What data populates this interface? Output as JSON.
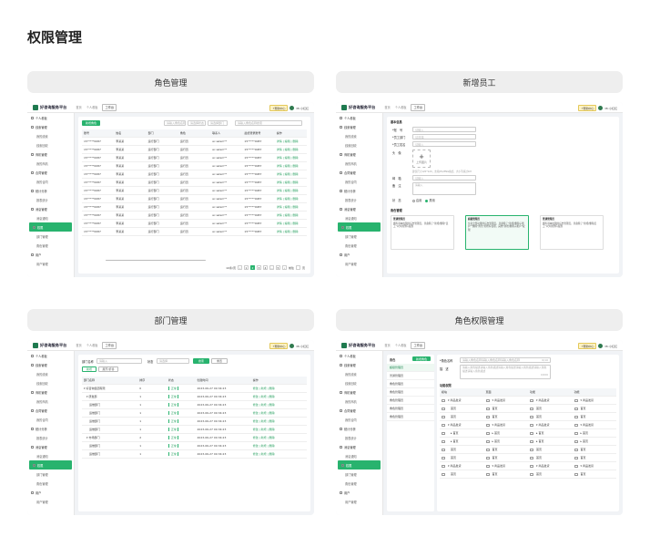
{
  "page_title": "权限管理",
  "panels": {
    "role": {
      "label": "角色管理"
    },
    "new_employee": {
      "label": "新增员工"
    },
    "dept": {
      "label": "部门管理"
    },
    "role_perm": {
      "label": "角色权限管理"
    }
  },
  "app": {
    "brand": "好咨询服务平台",
    "nav": [
      "首页",
      "个人看板",
      "工作台"
    ],
    "help": "⚡帮助中心",
    "user": "Mr.小红红"
  },
  "sidebar": [
    {
      "label": "个人看板",
      "sub": false
    },
    {
      "label": "线索管理",
      "sub": false
    },
    {
      "label": "我的线索",
      "sub": true
    },
    {
      "label": "线索回收",
      "sub": true
    },
    {
      "label": "商机管理",
      "sub": false
    },
    {
      "label": "我的商机",
      "sub": true
    },
    {
      "label": "合同管理",
      "sub": false
    },
    {
      "label": "我的合同",
      "sub": true
    },
    {
      "label": "统计分析",
      "sub": false
    },
    {
      "label": "报表统计",
      "sub": true
    },
    {
      "label": "消息管理",
      "sub": false
    },
    {
      "label": "消息通知",
      "sub": true
    },
    {
      "label": "权限",
      "sub": false,
      "active": true
    },
    {
      "label": "部门管理",
      "sub": true
    },
    {
      "label": "角色管理",
      "sub": true
    },
    {
      "label": "用户",
      "sub": false
    },
    {
      "label": "用户管理",
      "sub": true
    }
  ],
  "role_mgmt": {
    "add_button": "新增角色",
    "filters": [
      "请输入角色名称",
      "请选择状态",
      "请选择部门"
    ],
    "search_placeholder": "请输入角色名称搜索",
    "columns": [
      "账号",
      "姓名",
      "部门",
      "角色",
      "联系人",
      "最终登录账号",
      "操作"
    ],
    "rows": [
      [
        "15*****0087",
        "李某某",
        "运行部门",
        "运行员",
        "ac.wksm**",
        "15*****0087",
        "详情 | 编辑 | 删除"
      ],
      [
        "15*****0087",
        "李某某",
        "运行部门",
        "运行员",
        "ac.wksm**",
        "15*****0087",
        "详情 | 编辑 | 删除"
      ],
      [
        "15*****0087",
        "李某某",
        "运行部门",
        "运行员",
        "ac.wksm**",
        "15*****0087",
        "详情 | 编辑 | 删除"
      ],
      [
        "15*****0087",
        "李某某",
        "运行部门",
        "运行员",
        "ac.wksm**",
        "15*****0087",
        "详情 | 编辑 | 删除"
      ],
      [
        "15*****0087",
        "李某某",
        "运行部门",
        "运行员",
        "ac.wksm**",
        "15*****0087",
        "详情 | 编辑 | 删除"
      ],
      [
        "15*****0087",
        "李某某",
        "运行部门",
        "运行员",
        "ac.wksm**",
        "15*****0087",
        "详情 | 编辑 | 删除"
      ],
      [
        "15*****0087",
        "李某某",
        "运行部门",
        "运行员",
        "ac.wksm**",
        "15*****0087",
        "详情 | 编辑 | 删除"
      ],
      [
        "15*****0087",
        "李某某",
        "运行部门",
        "运行员",
        "ac.wksm**",
        "15*****0087",
        "详情 | 编辑 | 删除"
      ],
      [
        "15*****0087",
        "李某某",
        "运行部门",
        "运行员",
        "ac.wksm**",
        "15*****0087",
        "详情 | 编辑 | 删除"
      ],
      [
        "15*****0087",
        "李某某",
        "运行部门",
        "运行员",
        "ac.wksm**",
        "15*****0087",
        "详情 | 编辑 | 删除"
      ],
      [
        "15*****0087",
        "李某某",
        "运行部门",
        "运行员",
        "ac.wksm**",
        "15*****0087",
        "详情 | 编辑 | 删除"
      ],
      [
        "15*****0087",
        "李某某",
        "运行部门",
        "运行员",
        "ac.wksm**",
        "15*****0087",
        "详情 | 编辑 | 删除"
      ]
    ],
    "pager": {
      "per_page": "10条/页",
      "pages": [
        "1",
        "2",
        "3",
        "4",
        "...",
        "5"
      ],
      "goto": "前往",
      "page_suffix": "页"
    }
  },
  "new_emp": {
    "section_basic": "基本信息",
    "fields": [
      {
        "label": "*账　号",
        "placeholder": "请输入"
      },
      {
        "label": "*员工部门",
        "placeholder": "请选择"
      },
      {
        "label": "*员工姓名",
        "placeholder": "请输入"
      }
    ],
    "avatar_label": "头　像",
    "upload_text": "上传图片",
    "upload_hint": "建议尺寸120*120，支持JPG/PNG格式，大小不超过1M",
    "email_label": "邮　箱",
    "email_placeholder": "请输入",
    "remark_label": "备　注",
    "remark_placeholder": "请输入",
    "status_label": "状　态",
    "status_options": [
      "启用",
      "禁用"
    ],
    "section_role": "角色管理",
    "cards": [
      {
        "title": "普通管理员",
        "text": "拥有基本权限的后台管理员，具备除了\"新增/删除\"员工\"以外的所有权限"
      },
      {
        "title": "超级管理员",
        "text": "负责全部功能的后台管理员，具备除了\"新增/删除子账户\"\"删除\"角色\"的所有权限，其他\"新增/删除子账户\"权限"
      },
      {
        "title": "普通管理员",
        "text": "拥有基本权限的后台管理员，具备除了\"新增/删除员工\"以外的所有权限"
      }
    ]
  },
  "dept_mgmt": {
    "name_label": "部门名称",
    "name_placeholder": "请输入",
    "status_label": "状态",
    "status_placeholder": "请选择",
    "search_btn": "搜索",
    "reset_btn": "重置",
    "add_btn": "新增",
    "expand_btn": "展开/折叠",
    "columns": [
      "部门名称",
      "排序",
      "状态",
      "创建时间",
      "操作"
    ],
    "rows": [
      {
        "name": "▾ 好咨询集团有限",
        "sort": "0",
        "status": "正常",
        "time": "2023-06-27 09:34:23",
        "ops": "修改 | 新增 | 删除"
      },
      {
        "name": "　▾ 研发部",
        "sort": "1",
        "status": "正常",
        "time": "2023-06-27 09:34:23",
        "ops": "修改 | 新增 | 删除"
      },
      {
        "name": "　　运维部门",
        "sort": "1",
        "status": "正常",
        "time": "2023-06-27 09:34:23",
        "ops": "修改 | 新增 | 删除"
      },
      {
        "name": "　　运维部门",
        "sort": "1",
        "status": "正常",
        "time": "2023-06-27 09:34:23",
        "ops": "修改 | 新增 | 删除"
      },
      {
        "name": "　　运维部门",
        "sort": "1",
        "status": "正常",
        "time": "2023-06-27 09:34:23",
        "ops": "修改 | 新增 | 删除"
      },
      {
        "name": "　　运维部门",
        "sort": "1",
        "status": "正常",
        "time": "2023-06-27 09:34:23",
        "ops": "修改 | 新增 | 删除"
      },
      {
        "name": "　▾ 市场部门",
        "sort": "2",
        "status": "正常",
        "time": "2023-06-27 09:34:23",
        "ops": "修改 | 新增 | 删除"
      },
      {
        "name": "　　运维部门",
        "sort": "1",
        "status": "正常",
        "time": "2023-06-27 09:34:23",
        "ops": "修改 | 新增 | 删除"
      },
      {
        "name": "　　运维部门",
        "sort": "1",
        "status": "正常",
        "time": "2023-06-27 09:34:23",
        "ops": "修改 | 新增 | 删除"
      }
    ]
  },
  "role_perm": {
    "role_header": "角色",
    "add_role": "新增角色",
    "roles": [
      "超级管理员",
      "普通管理员",
      "角色管理员",
      "角色管理员",
      "角色管理员",
      "角色管理员",
      "角色管理员"
    ],
    "name_label": "*角色名称",
    "name_placeholder": "请输入角色名称请输入角色名称请输入角色名称",
    "name_count": "0/10",
    "desc_label": "描　述",
    "desc_placeholder": "请输入角色描述请输入角色描述请输入角色描述请输入角色描述请输入角色描述请输入角色描述",
    "desc_count": "0/200",
    "perm_title": "功能权限",
    "perm_columns": [
      "模块",
      "页面",
      "功能",
      "功能"
    ],
    "perm_rows": [
      [
        "▾ 商品发货",
        "▾ 商品发货",
        "▾ 商品发货",
        "▾ 商品发货"
      ],
      [
        "　首页",
        "首页",
        "首页",
        "首页"
      ],
      [
        "　首页",
        "首页",
        "首页",
        "首页"
      ],
      [
        "▾ 商品发货",
        "▾ 商品发货",
        "▾ 商品发货",
        "▾ 商品发货"
      ],
      [
        "　▸ 首页",
        "▸ 首页",
        "▸ 首页",
        "▸ 首页"
      ],
      [
        "　▸ 首页",
        "▸ 首页",
        "▸ 首页",
        "▸ 首页"
      ],
      [
        "　首页",
        "首页",
        "首页",
        "首页"
      ],
      [
        "　首页",
        "首页",
        "首页",
        "首页"
      ],
      [
        "▾ 商品发货",
        "▾ 商品发货",
        "▾ 商品发货",
        "▾ 商品发货"
      ],
      [
        "　首页",
        "首页",
        "首页",
        "首页"
      ]
    ]
  },
  "colors": {
    "accent": "#28b36e",
    "panel_bg": "#eeeeee",
    "shot_bg": "#f1f3f6"
  }
}
